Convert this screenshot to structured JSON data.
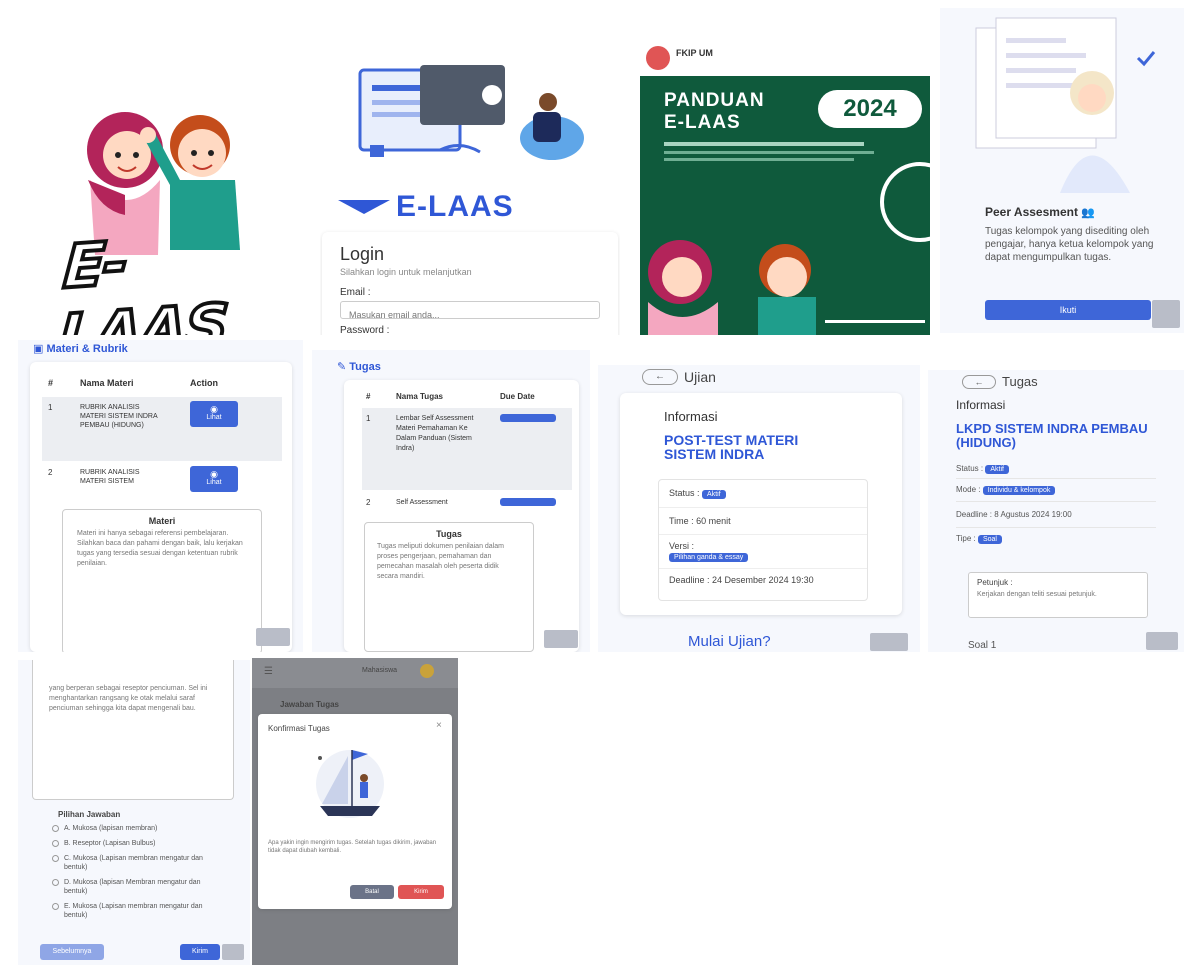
{
  "logo": {
    "wordmark": "E-LAAS"
  },
  "login": {
    "brand": "E-LAAS",
    "title": "Login",
    "subtitle": "Silahkan login untuk melanjutkan",
    "email_label": "Email :",
    "email_placeholder": "Masukan email anda...",
    "password_label": "Password :"
  },
  "poster": {
    "title_line1": "PANDUAN",
    "title_line2": "E-LAAS",
    "year": "2024",
    "institution": "FKIP UM"
  },
  "peer": {
    "title": "Peer Assesment",
    "description": "Tugas kelompok yang disediting oleh pengajar, hanya ketua kelompok yang dapat mengumpulkan tugas.",
    "button": "Ikuti"
  },
  "materi": {
    "header": "Materi & Rubrik",
    "col_no": "#",
    "col_name": "Nama Materi",
    "col_action": "Action",
    "rows": [
      {
        "no": "1",
        "name": "RUBRIK ANALISIS MATERI SISTEM INDRA PEMBAU (HIDUNG)",
        "action": "Lihat"
      },
      {
        "no": "2",
        "name": "RUBRIK ANALISIS MATERI SISTEM",
        "action": "Lihat"
      }
    ],
    "note_title": "Materi",
    "note_text": "Materi ini hanya sebagai referensi pembelajaran. Silahkan baca dan pahami dengan baik, lalu kerjakan tugas yang tersedia sesuai dengan ketentuan rubrik penilaian."
  },
  "tugas_list": {
    "header": "Tugas",
    "col_no": "#",
    "col_name": "Nama Tugas",
    "col_due": "Due Date",
    "rows": [
      {
        "no": "1",
        "name": "Lembar Self Assessment Materi Pemahaman Ke Dalam Panduan (Sistem Indra)"
      },
      {
        "no": "2",
        "name": "Self Assessment"
      }
    ],
    "note_title": "Tugas",
    "note_text": "Tugas meliputi dokumen penilaian dalam proses pengerjaan, pemahaman dan pemecahan masalah oleh peserta didik secara mandiri."
  },
  "ujian": {
    "back_label": "Ujian",
    "info_label": "Informasi",
    "title": "POST-TEST MATERI SISTEM INDRA",
    "status_label": "Status :",
    "status_value": "Aktif",
    "time_label": "Time : 60 menit",
    "version_label": "Versi :",
    "version_value": "Pilihan ganda & essay",
    "deadline_label": "Deadline : 24 Desember 2024 19:30",
    "start_label": "Mulai Ujian?"
  },
  "tugas_detail": {
    "back_label": "Tugas",
    "info_label": "Informasi",
    "title": "LKPD SISTEM INDRA PEMBAU (HIDUNG)",
    "status_label": "Status :",
    "status_value": "Aktif",
    "mode_label": "Mode :",
    "mode_value": "Individu & kelompok",
    "deadline_label": "Deadline : 8 Agustus 2024 19:00",
    "type_label": "Tipe :",
    "type_value": "Soal",
    "instruction_title": "Petunjuk :",
    "instruction_text": "Kerjakan dengan teliti sesuai petunjuk.",
    "question_label": "Soal 1"
  },
  "answer": {
    "passage": "yang berperan sebagai reseptor penciuman. Sel ini menghantarkan rangsang ke otak melalui saraf penciuman sehingga kita dapat mengenali bau.",
    "choices_title": "Pilihan Jawaban",
    "choices": [
      "A. Mukosa (lapisan membran)",
      "B. Reseptor (Lapisan Bulbus)",
      "C. Mukosa (Lapisan membran mengatur dan bentuk)",
      "D. Mukosa (lapisan Membran mengatur dan bentuk)",
      "E. Mukosa (Lapisan membran mengatur dan bentuk)"
    ],
    "prev_label": "Sebelumnya",
    "next_label": "Kirim"
  },
  "dialog": {
    "topbar_name": "Mahasiswa",
    "bg_title": "Jawaban Tugas",
    "title": "Konfirmasi Tugas",
    "message": "Apa yakin ingin mengirim tugas. Setelah tugas dikirim, jawaban tidak dapat diubah kembali.",
    "cancel": "Batal",
    "confirm": "Kirim"
  },
  "colors": {
    "primary": "#3e66d8",
    "title_blue": "#2f57d6",
    "poster_green": "#0f5a3c",
    "danger": "#e05555",
    "gray_button": "#b9bdc8"
  },
  "icons": [
    "graduation-cap-icon",
    "back-arrow-icon",
    "eye-icon",
    "book-icon",
    "pencil-icon",
    "group-icon",
    "close-icon",
    "check-icon",
    "flag-icon"
  ]
}
